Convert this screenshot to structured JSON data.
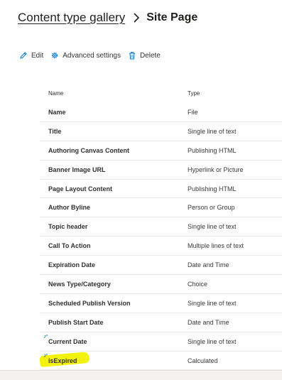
{
  "breadcrumb": {
    "parent": "Content type gallery",
    "current": "Site Page"
  },
  "commands": {
    "edit": "Edit",
    "advanced": "Advanced settings",
    "delete": "Delete"
  },
  "table": {
    "headers": {
      "name": "Name",
      "type": "Type"
    },
    "rows": [
      {
        "name": "Name",
        "type": "File"
      },
      {
        "name": "Title",
        "type": "Single line of text"
      },
      {
        "name": "Authoring Canvas Content",
        "type": "Publishing HTML"
      },
      {
        "name": "Banner Image URL",
        "type": "Hyperlink or Picture"
      },
      {
        "name": "Page Layout Content",
        "type": "Publishing HTML"
      },
      {
        "name": "Author Byline",
        "type": "Person or Group"
      },
      {
        "name": "Topic header",
        "type": "Single line of text"
      },
      {
        "name": "Call To Action",
        "type": "Multiple lines of text"
      },
      {
        "name": "Expiration Date",
        "type": "Date and Time"
      },
      {
        "name": "News Type/Category",
        "type": "Choice"
      },
      {
        "name": "Scheduled Publish Version",
        "type": "Single line of text"
      },
      {
        "name": "Publish Start Date",
        "type": "Date and Time"
      },
      {
        "name": "Current Date",
        "type": "Single line of text"
      },
      {
        "name": "isExpired",
        "type": "Calculated"
      }
    ]
  },
  "colors": {
    "accent": "#0078d4",
    "highlight": "#f2f20a"
  },
  "icons": {
    "separator": "chevron-right-icon",
    "edit": "pencil-icon",
    "advanced": "gear-icon",
    "delete": "trash-icon"
  }
}
